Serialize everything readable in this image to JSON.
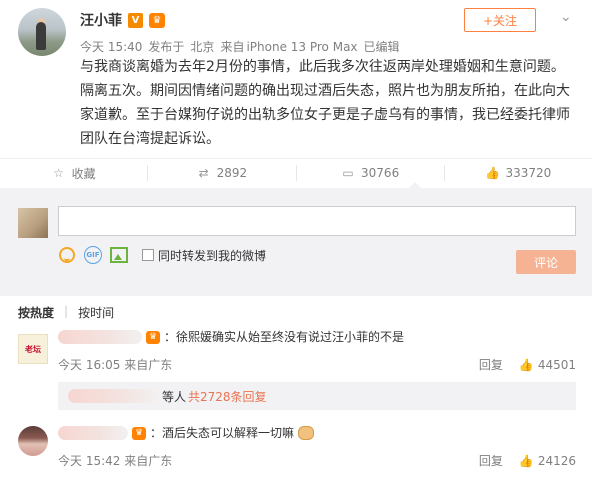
{
  "post": {
    "username": "汪小菲",
    "verified_badge": "V",
    "meta": {
      "time": "今天 15:40",
      "published_from_label": "发布于",
      "location": "北京",
      "source_prefix": "来自",
      "device": "iPhone 13 Pro Max",
      "edited": "已编辑"
    },
    "follow_button": "+关注",
    "text": "与我商谈离婚为去年2月份的事情，此后我多次往返两岸处理婚姻和生意问题。隔离五次。期间因情绪问题的确出现过酒后失态，照片也为朋友所拍，在此向大家道歉。至于台媒狗仔说的出轨多位女子更是子虚乌有的事情，我已经委托律师团队在台湾提起诉讼。"
  },
  "actions": [
    {
      "icon": "star-icon",
      "label": "收藏"
    },
    {
      "icon": "repost-icon",
      "label": "2892"
    },
    {
      "icon": "comment-icon",
      "label": "30766"
    },
    {
      "icon": "thumb-up-icon",
      "label": "333720"
    }
  ],
  "composer": {
    "input_placeholder": "",
    "repost_checkbox_label": "同时转发到我的微博",
    "submit_label": "评论"
  },
  "sort": {
    "by_hot": "按热度",
    "by_time": "按时间"
  },
  "comments": [
    {
      "avatar_text": "老坛",
      "text": "：徐熙媛确实从始至终没有说过汪小菲的不是",
      "time": "今天 16:05 来自广东",
      "reply_label": "回复",
      "likes": "44501",
      "replies_prefix": "等人",
      "replies_count": "共2728条回复"
    },
    {
      "text": "：酒后失态可以解释一切嘛",
      "time": "今天 15:42 来自广东",
      "reply_label": "回复",
      "likes": "24126"
    }
  ]
}
